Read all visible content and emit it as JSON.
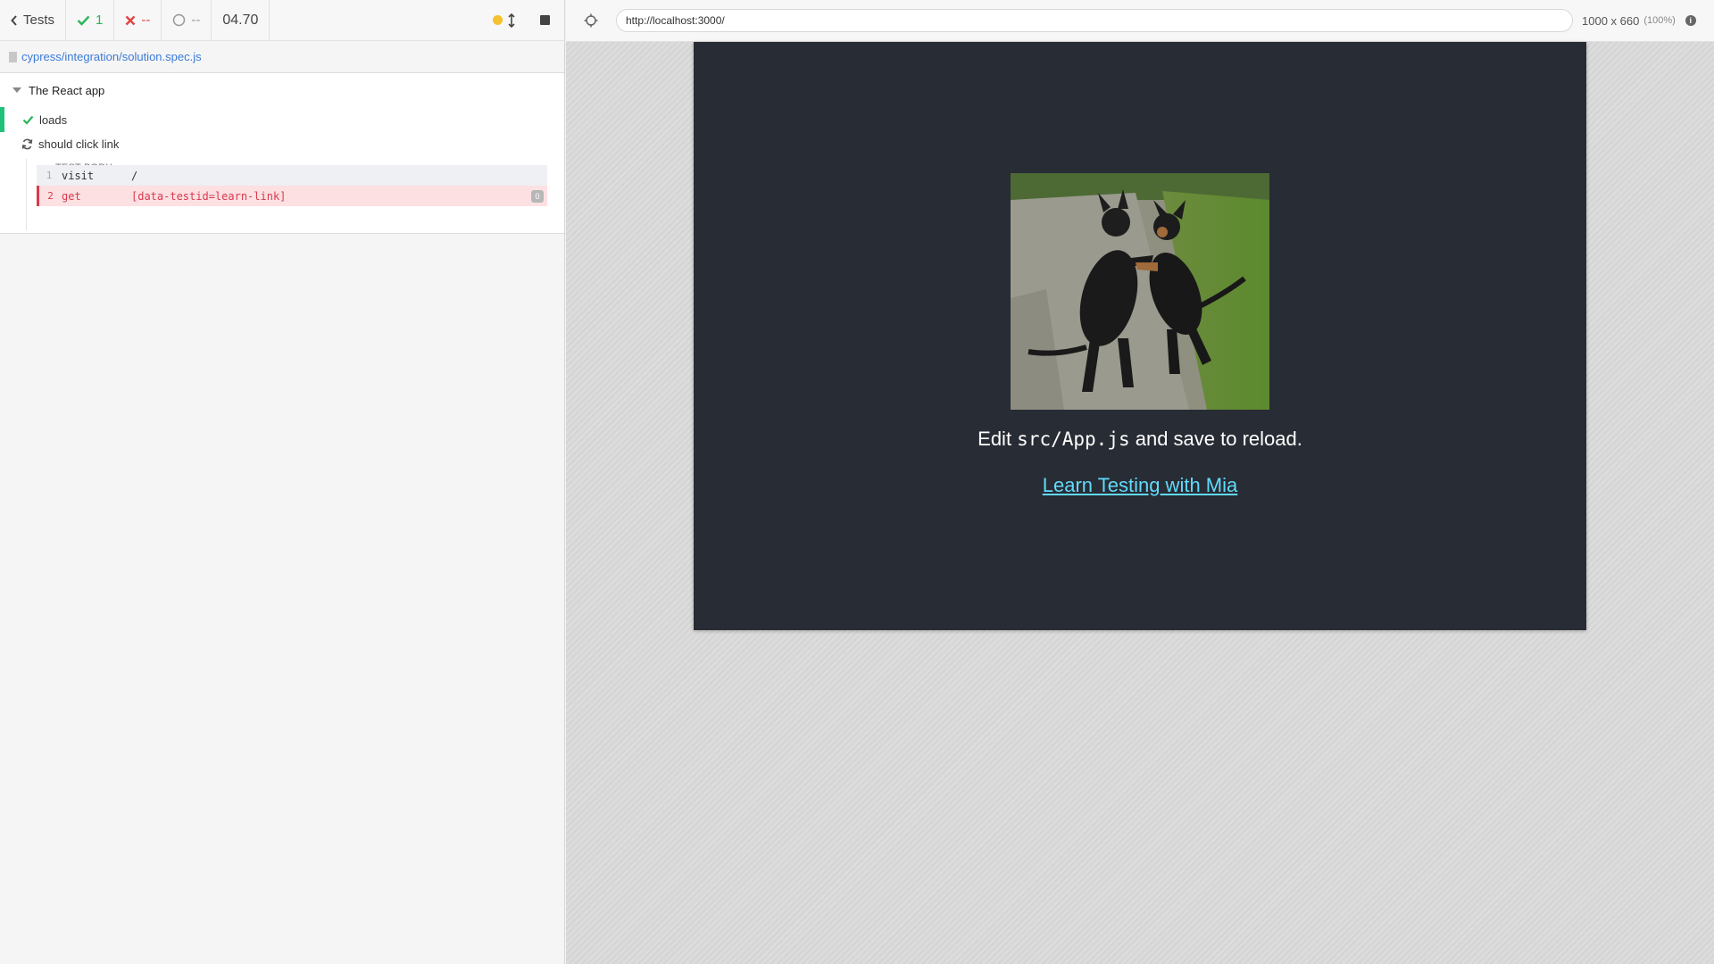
{
  "reporter": {
    "stats": {
      "tests_label": "Tests",
      "passed": "1",
      "failed": "--",
      "pending": "--",
      "duration": "04.70"
    },
    "spec_path": "cypress/integration/solution.spec.js",
    "suite": {
      "title": "The React app",
      "tests": [
        {
          "title": "loads",
          "state": "passed"
        },
        {
          "title": "should click link",
          "state": "running"
        }
      ],
      "body_label": "TEST BODY",
      "commands": [
        {
          "num": "1",
          "name": "visit",
          "message": "/",
          "state": "passed"
        },
        {
          "num": "2",
          "name": "get",
          "message": "[data-testid=learn-link]",
          "state": "failed",
          "count": "0"
        }
      ]
    }
  },
  "aut": {
    "url": "http://localhost:3000/",
    "viewport": "1000 x 660",
    "viewport_pct": "(100%)",
    "app": {
      "text_before": "Edit ",
      "code": "src/App.js",
      "text_after": " and save to reload.",
      "link": "Learn Testing with Mia"
    }
  },
  "colors": {
    "passed": "#2bb55a",
    "failed": "#e04545",
    "app_bg": "#282c34",
    "link": "#61dafb"
  }
}
